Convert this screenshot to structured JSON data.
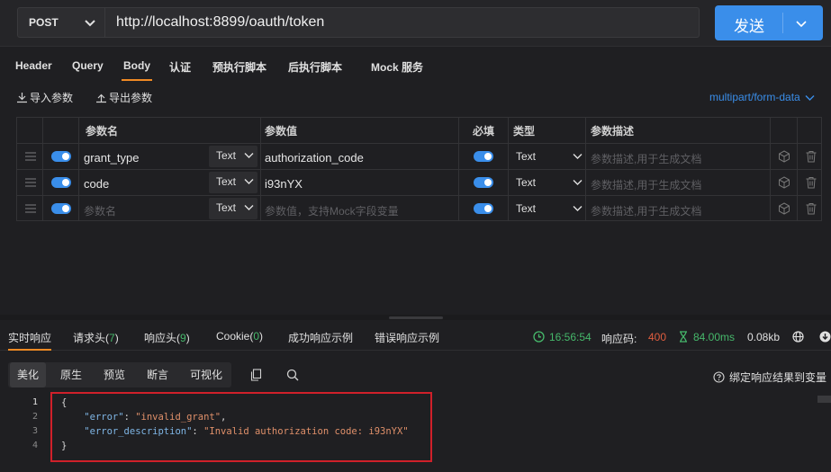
{
  "request": {
    "method": "POST",
    "url": "http://localhost:8899/oauth/token",
    "send_label": "发送"
  },
  "request_tabs": [
    {
      "label": "Header"
    },
    {
      "label": "Query"
    },
    {
      "label": "Body",
      "active": true
    },
    {
      "label": "认证"
    },
    {
      "label": "预执行脚本"
    },
    {
      "label": "后执行脚本"
    },
    {
      "label": "Mock 服务"
    }
  ],
  "body": {
    "import_label": "导入参数",
    "export_label": "导出参数",
    "content_type": "multipart/form-data",
    "columns": {
      "name": "参数名",
      "value": "参数值",
      "required": "必填",
      "type": "类型",
      "desc": "参数描述"
    },
    "rows": [
      {
        "name": "grant_type",
        "value_type": "Text",
        "value": "authorization_code",
        "type": "Text",
        "desc_placeholder": "参数描述,用于生成文档"
      },
      {
        "name": "code",
        "value_type": "Text",
        "value": "i93nYX",
        "type": "Text",
        "desc_placeholder": "参数描述,用于生成文档"
      }
    ],
    "new_row": {
      "name_placeholder": "参数名",
      "value_type": "Text",
      "value_placeholder": "参数值，支持Mock字段变量",
      "type": "Text",
      "desc_placeholder": "参数描述,用于生成文档"
    }
  },
  "response_tabs": {
    "realtime": "实时响应",
    "req_headers": "请求头(",
    "req_headers_count": "7",
    "resp_headers": "响应头(",
    "resp_headers_count": "9",
    "cookie": "Cookie(",
    "cookie_count": "0",
    "close_paren": ")",
    "success_example": "成功响应示例",
    "error_example": "错误响应示例"
  },
  "status": {
    "time": "16:56:54",
    "code_label": "响应码:",
    "code": "400",
    "duration": "84.00ms",
    "size": "0.08kb"
  },
  "format_tabs": [
    "美化",
    "原生",
    "预览",
    "断言",
    "可视化"
  ],
  "bind_label": "绑定响应结果到变量",
  "response_body": {
    "line_numbers": [
      "1",
      "2",
      "3",
      "4"
    ],
    "open_brace": "{",
    "close_brace": "}",
    "error_key": "\"error\"",
    "error_value": "\"invalid_grant\"",
    "desc_key": "\"error_description\"",
    "desc_value": "\"Invalid authorization code: i93nYX\""
  },
  "colors": {
    "accent": "#3a8eea",
    "tab_underline": "#f08a24",
    "status_green": "#46b86b",
    "status_red": "#e05d3f",
    "highlight_box": "#d0202a"
  }
}
